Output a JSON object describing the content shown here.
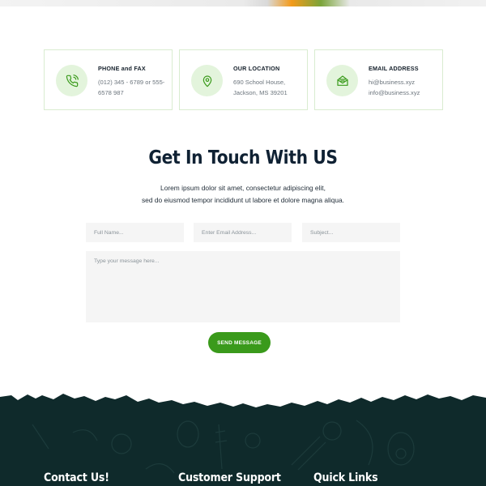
{
  "cards": [
    {
      "title": "PHONE and FAX",
      "lines": [
        "(012) 345 - 6789 or 555-",
        "6578 987"
      ],
      "icon": "phone-icon"
    },
    {
      "title": "OUR LOCATION",
      "lines": [
        "690 School House,",
        "Jackson, MS 39201"
      ],
      "icon": "location-pin-icon"
    },
    {
      "title": "EMAIL ADDRESS",
      "lines": [
        "hi@business.xyz",
        "info@business.xyz"
      ],
      "icon": "envelope-icon"
    }
  ],
  "contact": {
    "heading": "Get In Touch With US",
    "intro_line1": "Lorem ipsum dolor sit amet, consectetur adipiscing elit,",
    "intro_line2": "sed do eiusmod tempor incididunt ut labore et dolore magna aliqua."
  },
  "form": {
    "name_placeholder": "Full Name...",
    "email_placeholder": "Enter Email Address...",
    "subject_placeholder": "Subject...",
    "message_placeholder": "Type your message here...",
    "send_label": "SEND MESSAGE"
  },
  "footer": {
    "col1_title": "Contact Us!",
    "col2_title": "Customer Support",
    "col3_title": "Quick Links"
  },
  "colors": {
    "accent_green": "#3a9a1b",
    "icon_bg": "#e3f4dc",
    "card_border": "#d9ecd0",
    "footer_bg": "#0f2a2b",
    "heading": "#0f2133"
  }
}
